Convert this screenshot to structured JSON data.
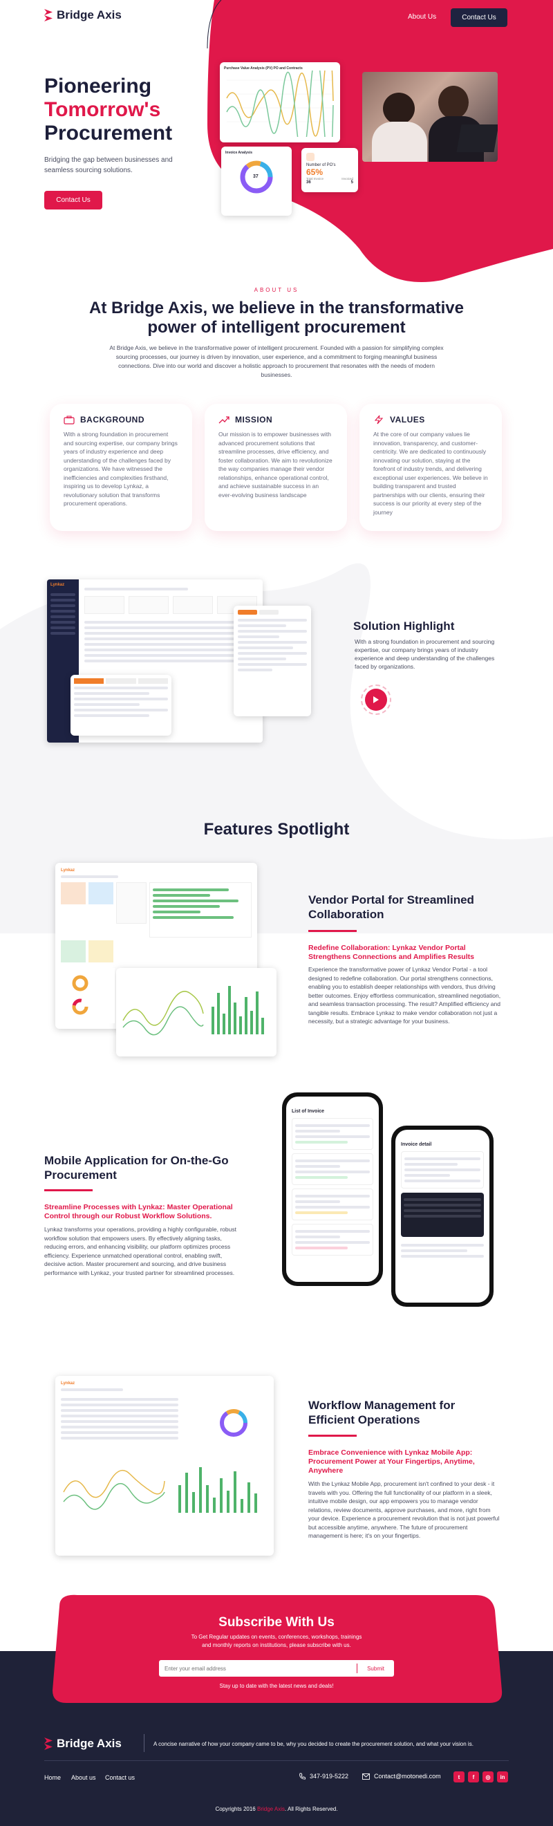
{
  "header": {
    "brand": "Bridge Axis",
    "nav_about": "About Us",
    "nav_contact": "Contact Us"
  },
  "hero": {
    "title_1": "Pioneering",
    "title_2": "Tomorrow's",
    "title_3": "Procurement",
    "subtitle": "Bridging the gap between businesses and seamless sourcing solutions.",
    "cta": "Contact Us",
    "chart_title": "Purchase Value Analysis (PV) PO and Contracts",
    "donut_title": "Invoice Analysis",
    "donut_value": "37",
    "po_card_title": "Number of PO's",
    "po_card_value": "65%",
    "po_card_sub1": "Total Invoice",
    "po_card_sub2": "Invoiced",
    "po_card_n1": "36",
    "po_card_n2": "5"
  },
  "about": {
    "eyebrow": "ABOUT US",
    "title": "At Bridge Axis, we believe in the transformative power of intelligent procurement",
    "text": "At Bridge Axis, we believe in the transformative power of intelligent procurement. Founded with a passion for simplifying complex sourcing processes, our journey is driven by innovation, user experience, and a commitment to forging meaningful business connections. Dive into our world and discover a holistic approach to procurement that resonates with the needs of modern businesses."
  },
  "values": [
    {
      "title": "BACKGROUND",
      "text": "With a strong foundation in procurement and sourcing expertise, our company brings years of industry experience and deep understanding of the challenges faced by organizations. We have witnessed the inefficiencies and complexities firsthand, inspiring us to develop Lynkaz, a revolutionary solution that transforms procurement operations."
    },
    {
      "title": "MISSION",
      "text": "Our mission is to empower businesses with advanced procurement solutions that streamline processes, drive efficiency, and foster collaboration. We aim to revolutionize the way companies manage their vendor relationships, enhance operational control, and achieve sustainable success in an ever-evolving business landscape"
    },
    {
      "title": "VALUES",
      "text": "At the core of our company values lie innovation, transparency, and customer-centricity. We are dedicated to continuously innovating our solution, staying at the forefront of industry trends, and delivering exceptional user experiences. We believe in building transparent and trusted partnerships with our clients, ensuring their success is our priority at every step of the journey"
    }
  ],
  "solution": {
    "title": "Solution Highlight",
    "text": "With a strong foundation in procurement and sourcing expertise, our company brings years of industry experience and deep understanding of the challenges faced by organizations."
  },
  "features": {
    "title": "Features Spotlight",
    "vendor": {
      "title": "Vendor Portal for Streamlined Collaboration",
      "subtitle": "Redefine Collaboration: Lynkaz Vendor Portal Strengthens Connections and Amplifies Results",
      "text": "Experience the transformative power of Lynkaz Vendor Portal - a tool designed to redefine collaboration. Our portal strengthens connections, enabling you to establish deeper relationships with vendors, thus driving better outcomes. Enjoy effortless communication, streamlined negotiation, and seamless transaction processing. The result? Amplified efficiency and tangible results. Embrace Lynkaz to make vendor collaboration not just a necessity, but a strategic advantage for your business."
    },
    "mobile": {
      "title": "Mobile Application for On-the-Go Procurement",
      "subtitle": "Streamline Processes with Lynkaz: Master Operational Control through our Robust Workflow Solutions.",
      "text": "Lynkaz transforms your operations, providing a highly configurable, robust workflow solution that empowers users. By effectively aligning tasks, reducing errors, and enhancing visibility, our platform optimizes process efficiency. Experience unmatched operational control, enabling swift, decisive action. Master procurement and sourcing, and drive business performance with Lynkaz, your trusted partner for streamlined processes.",
      "phone1_title": "List of Invoice",
      "phone2_title": "Invoice detail"
    },
    "workflow": {
      "title": "Workflow Management for Efficient Operations",
      "subtitle": "Embrace Convenience with Lynkaz Mobile App: Procurement Power at Your Fingertips, Anytime, Anywhere",
      "text": "With the Lynkaz Mobile App, procurement isn't confined to your desk - it travels with you. Offering the full functionality of our platform in a sleek, intuitive mobile design, our app empowers you to manage vendor relations, review documents, approve purchases, and more, right from your device. Experience a procurement revolution that is not just powerful but accessible anytime, anywhere. The future of procurement management is here; it's on your fingertips."
    }
  },
  "subscribe": {
    "title": "Subscribe With Us",
    "text": "To Get Regular updates on events, conferences, workshops, trainings and monthly reports on institutions, please subscribe with us.",
    "placeholder": "Enter your email address",
    "button": "Submit",
    "note": "Stay up to date with the latest news and deals!"
  },
  "footer": {
    "brand": "Bridge Axis",
    "tagline": "A concise narrative of how your company came to be, why you decided to create the procurement solution, and what your vision is.",
    "links": [
      "Home",
      "About us",
      "Contact us"
    ],
    "phone": "347-919-5222",
    "email": "Contact@motonedi.com",
    "copyright_pre": "Copyrights 2016",
    "copyright_brand": "Bridge Axis",
    "copyright_post": ". All Rights Reserved."
  },
  "colors": {
    "accent": "#e0184a",
    "navy": "#1d1f3a",
    "footer_bg": "#1f2238"
  }
}
